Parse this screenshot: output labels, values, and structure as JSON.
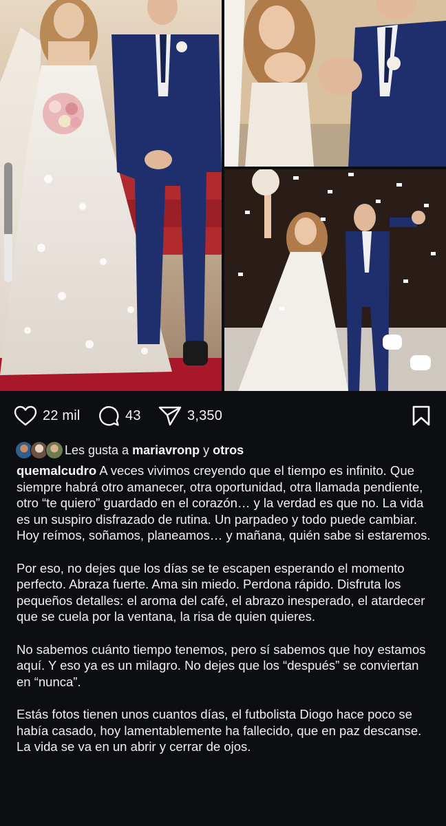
{
  "post": {
    "images": {
      "left_alt": "bride-and-groom-standing-at-altar",
      "top_right_alt": "couple-showing-wedding-rings",
      "bottom_right_alt": "couple-walking-out-under-confetti"
    },
    "actions": {
      "like_count": "22 mil",
      "comment_count": "43",
      "share_count": "3,350",
      "like_icon": "heart-icon",
      "comment_icon": "comment-bubble-icon",
      "share_icon": "send-paper-plane-icon",
      "save_icon": "bookmark-icon"
    },
    "likes": {
      "prefix": "Les gusta a ",
      "user": "mariavronp",
      "connector": " y ",
      "others": "otros"
    },
    "caption": {
      "username": "quemalcudro",
      "paragraph_1": "A veces vivimos creyendo que el tiempo es infinito. Que siempre habrá otro amanecer, otra oportunidad, otra llamada pendiente, otro “te quiero” guardado en el corazón… y la verdad es que no. La vida es un suspiro disfrazado de rutina. Un parpadeo y todo puede cambiar. Hoy reímos, soñamos, planeamos… y mañana, quién sabe si estaremos.",
      "paragraph_2": "Por eso, no dejes que los días se te escapen esperando el momento perfecto. Abraza fuerte. Ama sin miedo. Perdona rápido. Disfruta los pequeños detalles: el aroma del café, el abrazo inesperado, el atardecer que se cuela por la ventana, la risa de quien quieres.",
      "paragraph_3": "No sabemos cuánto tiempo tenemos, pero sí sabemos que hoy estamos aquí. Y eso ya es un milagro. No dejes que los “después” se conviertan en “nunca”.",
      "paragraph_4": "Estás fotos tienen unos cuantos días, el futbolista Diogo hace poco se había casado, hoy lamentablemente ha fallecido, que en paz descanse. La vida se va en un abrir y cerrar de ojos."
    }
  },
  "colors": {
    "background": "#0d0e12",
    "text": "#efefef",
    "icon": "#f5f5f5",
    "suit_blue": "#1f2f6e",
    "carpet_red": "#a8182a"
  }
}
